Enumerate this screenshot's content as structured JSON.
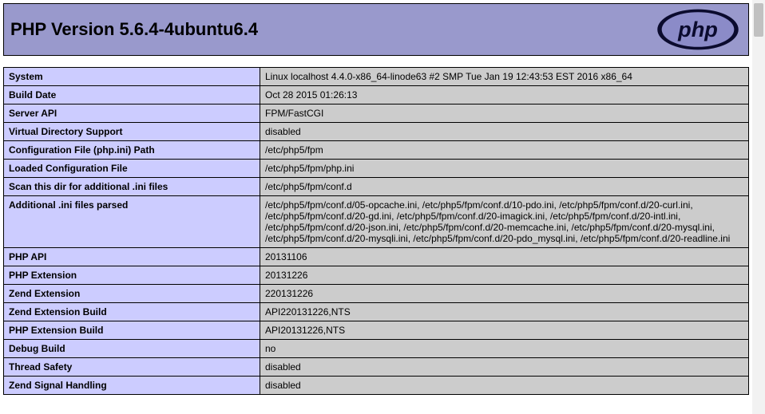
{
  "header": {
    "title": "PHP Version 5.6.4-4ubuntu6.4"
  },
  "rows": [
    {
      "key": "System",
      "value": "Linux localhost 4.4.0-x86_64-linode63 #2 SMP Tue Jan 19 12:43:53 EST 2016 x86_64"
    },
    {
      "key": "Build Date",
      "value": "Oct 28 2015 01:26:13"
    },
    {
      "key": "Server API",
      "value": "FPM/FastCGI"
    },
    {
      "key": "Virtual Directory Support",
      "value": "disabled"
    },
    {
      "key": "Configuration File (php.ini) Path",
      "value": "/etc/php5/fpm"
    },
    {
      "key": "Loaded Configuration File",
      "value": "/etc/php5/fpm/php.ini"
    },
    {
      "key": "Scan this dir for additional .ini files",
      "value": "/etc/php5/fpm/conf.d"
    },
    {
      "key": "Additional .ini files parsed",
      "value": "/etc/php5/fpm/conf.d/05-opcache.ini, /etc/php5/fpm/conf.d/10-pdo.ini, /etc/php5/fpm/conf.d/20-curl.ini, /etc/php5/fpm/conf.d/20-gd.ini, /etc/php5/fpm/conf.d/20-imagick.ini, /etc/php5/fpm/conf.d/20-intl.ini, /etc/php5/fpm/conf.d/20-json.ini, /etc/php5/fpm/conf.d/20-memcache.ini, /etc/php5/fpm/conf.d/20-mysql.ini, /etc/php5/fpm/conf.d/20-mysqli.ini, /etc/php5/fpm/conf.d/20-pdo_mysql.ini, /etc/php5/fpm/conf.d/20-readline.ini"
    },
    {
      "key": "PHP API",
      "value": "20131106"
    },
    {
      "key": "PHP Extension",
      "value": "20131226"
    },
    {
      "key": "Zend Extension",
      "value": "220131226"
    },
    {
      "key": "Zend Extension Build",
      "value": "API220131226,NTS"
    },
    {
      "key": "PHP Extension Build",
      "value": "API20131226,NTS"
    },
    {
      "key": "Debug Build",
      "value": "no"
    },
    {
      "key": "Thread Safety",
      "value": "disabled"
    },
    {
      "key": "Zend Signal Handling",
      "value": "disabled"
    }
  ]
}
